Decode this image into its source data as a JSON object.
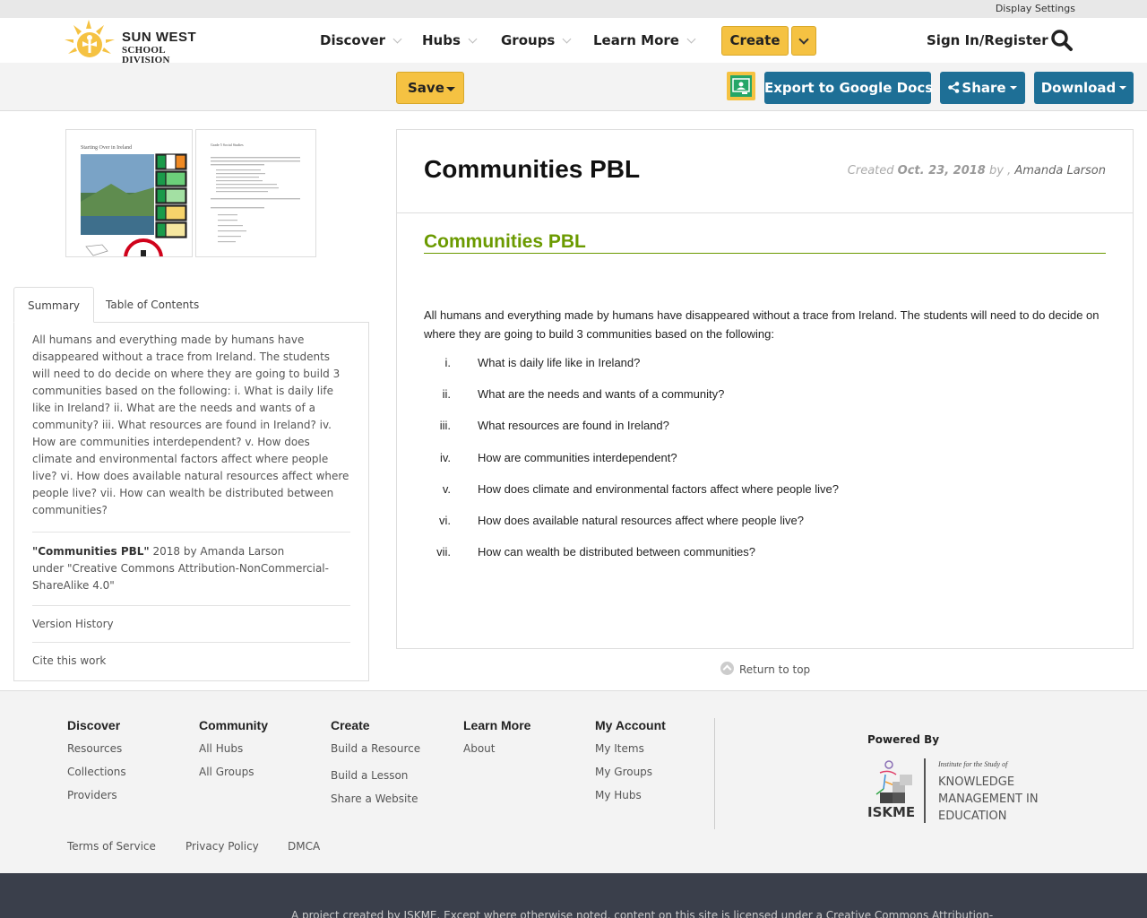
{
  "util": {
    "display_settings": "Display Settings"
  },
  "logo": {
    "line1": "SUN WEST",
    "line2": "SCHOOL DIVISION"
  },
  "nav": {
    "items": [
      {
        "label": "Discover"
      },
      {
        "label": "Hubs"
      },
      {
        "label": "Groups"
      },
      {
        "label": "Learn More"
      }
    ],
    "create": "Create",
    "signin": "Sign In/Register"
  },
  "toolbar": {
    "save": "Save",
    "export": "Export to Google Docs",
    "share": "Share",
    "download": "Download"
  },
  "sidebar": {
    "tabs": [
      "Summary",
      "Table of Contents"
    ],
    "summary": "All humans and everything made by humans have disappeared without a trace from Ireland. The students will need to do decide on where they are going to build 3 communities based on the following: i. What is daily life like in Ireland? ii. What are the needs and wants of a community? iii. What resources are found in Ireland? iv. How are communities interdependent? v. How does climate and environmental factors affect where people live? vi. How does available natural resources affect where people live? vii. How can wealth be distributed between communities?",
    "attribution_title": "\"Communities PBL\"",
    "attribution_year": "2018 by Amanda Larson",
    "attribution_license": "under \"Creative Commons Attribution-NonCommercial-ShareAlike 4.0\"",
    "version_history": "Version History",
    "cite": "Cite this work",
    "thumb1_title": "Starting Over in Ireland",
    "thumb2_title": "Grade 5 Social Studies"
  },
  "doc": {
    "title": "Communities PBL",
    "created_label": "Created",
    "date": "Oct. 23, 2018",
    "by": "by ,",
    "author": "Amanda Larson",
    "section_title": "Communities PBL",
    "intro": "All humans and everything made by humans have disappeared without a trace from Ireland. The students will need to do decide on where they are going to build 3 communities based on the following:",
    "questions": [
      {
        "num": "i.",
        "text": "What is daily life like in Ireland?"
      },
      {
        "num": "ii.",
        "text": "What are the needs and wants of a community?"
      },
      {
        "num": "iii.",
        "text": "What resources are found in Ireland?"
      },
      {
        "num": "iv.",
        "text": "How are communities interdependent?"
      },
      {
        "num": "v.",
        "text": "How does climate and environmental factors affect where people live?"
      },
      {
        "num": "vi.",
        "text": "How does available natural resources affect where people live?"
      },
      {
        "num": "vii.",
        "text": "How can wealth be distributed between communities?"
      }
    ],
    "return_top": "Return to top"
  },
  "footer": {
    "discover": {
      "heading": "Discover",
      "links": [
        "Resources",
        "Collections",
        "Providers"
      ]
    },
    "community": {
      "heading": "Community",
      "links": [
        "All Hubs",
        "All Groups"
      ]
    },
    "create": {
      "heading": "Create",
      "links": [
        "Build a Resource",
        "Build a Lesson",
        "Share a Website"
      ]
    },
    "learn": {
      "heading": "Learn More",
      "links": [
        "About"
      ]
    },
    "account": {
      "heading": "My Account",
      "links": [
        "My Items",
        "My Groups",
        "My Hubs"
      ]
    },
    "powered_by": "Powered By",
    "iskme_tag": "Institute for the Study of",
    "iskme_line1": "KNOWLEDGE",
    "iskme_line2": "MANAGEMENT IN",
    "iskme_line3": "EDUCATION",
    "iskme_name": "ISKME",
    "legal": [
      "Terms of Service",
      "Privacy Policy",
      "DMCA"
    ],
    "license": "A project created by ISKME. Except where otherwise noted, content on this site is licensed under a Creative Commons Attribution-"
  },
  "colors": {
    "accent_yellow": "#f5c242",
    "brand_blue": "#1e6f96",
    "section_green": "#6b9a00"
  }
}
